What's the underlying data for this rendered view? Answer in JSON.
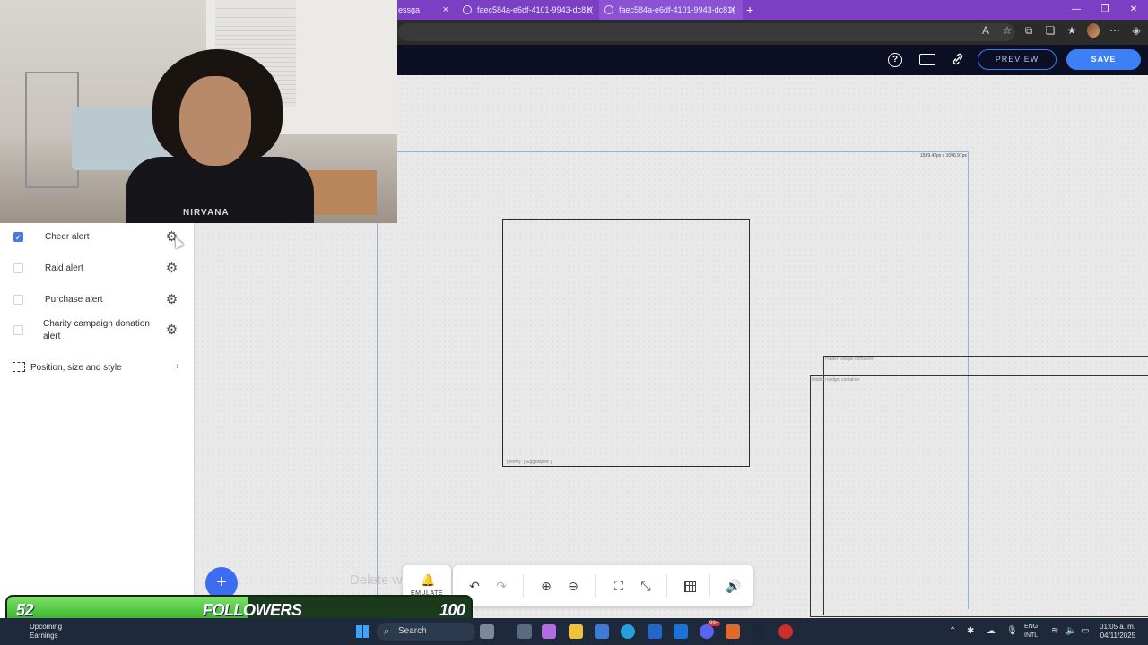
{
  "browser": {
    "tabs": [
      {
        "label": "essga",
        "close": "×"
      },
      {
        "label": "faec584a-e6df-4101-9943-dc81(",
        "close": "×"
      },
      {
        "label": "faec584a-e6df-4101-9943-dc81(",
        "close": "×"
      }
    ],
    "new_tab": "+",
    "window_controls": {
      "minimize": "—",
      "maximize": "❐",
      "close": "✕"
    }
  },
  "header": {
    "preview_label": "PREVIEW",
    "save_label": "SAVE",
    "help_icon": "?"
  },
  "canvas": {
    "size_readout": "1599.42px x 1096.97px",
    "alert_box_caption": "\"{lorem}\" {\"Eggswiped\"}",
    "frame_a_caption": "Hidden widget container",
    "frame_b_caption": "Hidden widget container"
  },
  "left_panel": {
    "alerts": [
      {
        "label": "Cheer alert",
        "checked": true
      },
      {
        "label": "Raid alert",
        "checked": false
      },
      {
        "label": "Purchase alert",
        "checked": false
      },
      {
        "label": "Charity campaign donation alert",
        "checked": false
      }
    ],
    "position_section": "Position, size and style",
    "check_mark": "✓",
    "chevron": "›",
    "gear": "⚙"
  },
  "webcam": {
    "shirt_text": "NIRVANA"
  },
  "floating": {
    "add_button": "+",
    "ghost_text": "Delete w",
    "emulate_label": "EMULATE",
    "bell": "🔔",
    "tools": {
      "undo": "↶",
      "redo": "↷",
      "zoom_in": "⊕",
      "zoom_out": "⊖",
      "fullscreen": "⛶",
      "exit_fullscreen": "⤡",
      "volume": "🔊"
    }
  },
  "follower_goal": {
    "current": "52",
    "label": "FOLLOWERS",
    "target": "100",
    "progress": 0.52
  },
  "taskbar": {
    "weather_title": "Upcoming",
    "weather_sub": "Earnings",
    "search_label": "Search",
    "lang_top": "ENG",
    "lang_bottom": "INTL",
    "time": "01:05 a. m.",
    "date": "04/11/2025",
    "notification_count": "99+"
  },
  "colors": {
    "tab_bar": "#7b3fc4",
    "app_header": "#0c0f24",
    "accent_blue": "#3d7ff4",
    "goal_green": "#4fc43f"
  }
}
